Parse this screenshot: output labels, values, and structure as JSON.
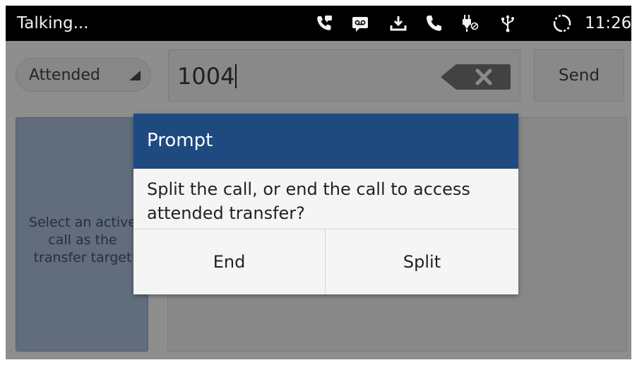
{
  "status_bar": {
    "title": "Talking...",
    "icons": [
      "call-forward-icon",
      "voicemail-icon",
      "download-icon",
      "phone-icon",
      "power-plug-icon",
      "usb-icon",
      "sync-icon"
    ],
    "time": "11:26"
  },
  "transfer": {
    "mode_label": "Attended",
    "number_value": "1004",
    "send_label": "Send"
  },
  "target_card": {
    "text": "Select an active\ncall as the\ntransfer target"
  },
  "dialog": {
    "title": "Prompt",
    "message": "Split the call, or end the call to access attended transfer?",
    "buttons": {
      "end": "End",
      "split": "Split"
    },
    "header_color": "#1e4a80"
  }
}
